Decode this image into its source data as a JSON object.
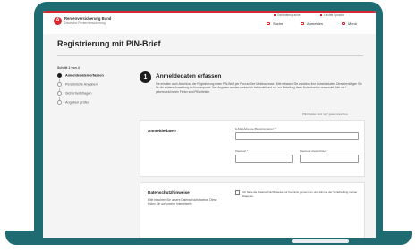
{
  "header": {
    "logo_mark": "A",
    "logo_name": "Rentenversicherung Bund",
    "logo_sub": "Deutsche Rentenversicherung",
    "utility_links": [
      "Gebärdensprache",
      "Leichte Sprache"
    ],
    "nav": [
      "Suche",
      "Anmelden",
      "Menü"
    ]
  },
  "page": {
    "title": "Registrierung mit PIN-Brief"
  },
  "steps": {
    "label": "Schritt 1 von 4",
    "items": [
      {
        "label": "Anmeldedaten erfassen",
        "active": true
      },
      {
        "label": "Persönliche Angaben",
        "active": false
      },
      {
        "label": "Sicherheitsfragen",
        "active": false
      },
      {
        "label": "Angaben prüfen",
        "active": false
      }
    ]
  },
  "section": {
    "number": "1",
    "title": "Anmeldedaten erfassen",
    "description": "Sie erhalten nach Abschluss der Registrierung einen PIN-Brief per Post an Ihre Meldeadresse. Bitte erfassen Sie zunächst Ihre Anmeldedaten. Diese benötigen Sie für die spätere Anmeldung im Kundenportal. Ihre Angaben werden vertraulich behandelt und nur zur Erstellung Ihres Nutzerkontos verwendet. Alle mit * gekennzeichneten Felder sind Pflichtfelder.",
    "mandatory_note": "Pflichtfelder sind mit * gekennzeichnet"
  },
  "login_card": {
    "heading": "Anmeldedaten",
    "email_label": "E-Mail-Adresse (Benutzername) *",
    "email_value": "",
    "password_label": "Passwort *",
    "password_value": "",
    "password_repeat_label": "Passwort wiederholen *",
    "password_repeat_value": ""
  },
  "privacy_card": {
    "heading": "Datenschutzhinweise",
    "text": "Bitte beachten Sie unsere Datenschutzhinweise. Diese finden Sie auf unserer Internetseite.",
    "checkbox_label": "Ich habe die Datenschutzhinweise zur Kenntnis genommen und stimme der Verarbeitung meiner Daten zu."
  }
}
